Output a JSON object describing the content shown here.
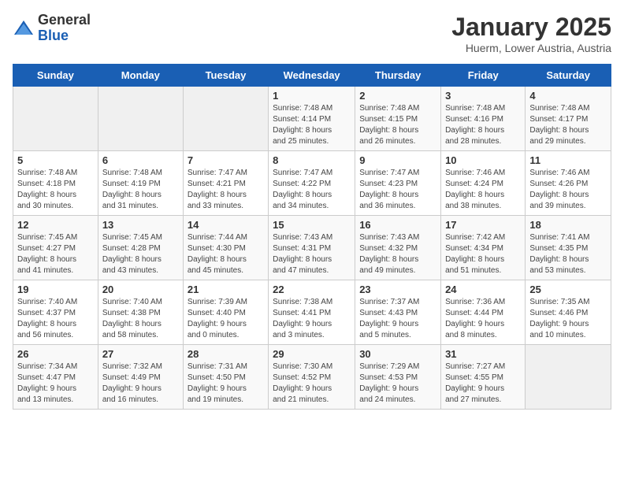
{
  "header": {
    "logo_general": "General",
    "logo_blue": "Blue",
    "month_title": "January 2025",
    "location": "Huerm, Lower Austria, Austria"
  },
  "days_of_week": [
    "Sunday",
    "Monday",
    "Tuesday",
    "Wednesday",
    "Thursday",
    "Friday",
    "Saturday"
  ],
  "weeks": [
    [
      {
        "day": "",
        "info": ""
      },
      {
        "day": "",
        "info": ""
      },
      {
        "day": "",
        "info": ""
      },
      {
        "day": "1",
        "info": "Sunrise: 7:48 AM\nSunset: 4:14 PM\nDaylight: 8 hours\nand 25 minutes."
      },
      {
        "day": "2",
        "info": "Sunrise: 7:48 AM\nSunset: 4:15 PM\nDaylight: 8 hours\nand 26 minutes."
      },
      {
        "day": "3",
        "info": "Sunrise: 7:48 AM\nSunset: 4:16 PM\nDaylight: 8 hours\nand 28 minutes."
      },
      {
        "day": "4",
        "info": "Sunrise: 7:48 AM\nSunset: 4:17 PM\nDaylight: 8 hours\nand 29 minutes."
      }
    ],
    [
      {
        "day": "5",
        "info": "Sunrise: 7:48 AM\nSunset: 4:18 PM\nDaylight: 8 hours\nand 30 minutes."
      },
      {
        "day": "6",
        "info": "Sunrise: 7:48 AM\nSunset: 4:19 PM\nDaylight: 8 hours\nand 31 minutes."
      },
      {
        "day": "7",
        "info": "Sunrise: 7:47 AM\nSunset: 4:21 PM\nDaylight: 8 hours\nand 33 minutes."
      },
      {
        "day": "8",
        "info": "Sunrise: 7:47 AM\nSunset: 4:22 PM\nDaylight: 8 hours\nand 34 minutes."
      },
      {
        "day": "9",
        "info": "Sunrise: 7:47 AM\nSunset: 4:23 PM\nDaylight: 8 hours\nand 36 minutes."
      },
      {
        "day": "10",
        "info": "Sunrise: 7:46 AM\nSunset: 4:24 PM\nDaylight: 8 hours\nand 38 minutes."
      },
      {
        "day": "11",
        "info": "Sunrise: 7:46 AM\nSunset: 4:26 PM\nDaylight: 8 hours\nand 39 minutes."
      }
    ],
    [
      {
        "day": "12",
        "info": "Sunrise: 7:45 AM\nSunset: 4:27 PM\nDaylight: 8 hours\nand 41 minutes."
      },
      {
        "day": "13",
        "info": "Sunrise: 7:45 AM\nSunset: 4:28 PM\nDaylight: 8 hours\nand 43 minutes."
      },
      {
        "day": "14",
        "info": "Sunrise: 7:44 AM\nSunset: 4:30 PM\nDaylight: 8 hours\nand 45 minutes."
      },
      {
        "day": "15",
        "info": "Sunrise: 7:43 AM\nSunset: 4:31 PM\nDaylight: 8 hours\nand 47 minutes."
      },
      {
        "day": "16",
        "info": "Sunrise: 7:43 AM\nSunset: 4:32 PM\nDaylight: 8 hours\nand 49 minutes."
      },
      {
        "day": "17",
        "info": "Sunrise: 7:42 AM\nSunset: 4:34 PM\nDaylight: 8 hours\nand 51 minutes."
      },
      {
        "day": "18",
        "info": "Sunrise: 7:41 AM\nSunset: 4:35 PM\nDaylight: 8 hours\nand 53 minutes."
      }
    ],
    [
      {
        "day": "19",
        "info": "Sunrise: 7:40 AM\nSunset: 4:37 PM\nDaylight: 8 hours\nand 56 minutes."
      },
      {
        "day": "20",
        "info": "Sunrise: 7:40 AM\nSunset: 4:38 PM\nDaylight: 8 hours\nand 58 minutes."
      },
      {
        "day": "21",
        "info": "Sunrise: 7:39 AM\nSunset: 4:40 PM\nDaylight: 9 hours\nand 0 minutes."
      },
      {
        "day": "22",
        "info": "Sunrise: 7:38 AM\nSunset: 4:41 PM\nDaylight: 9 hours\nand 3 minutes."
      },
      {
        "day": "23",
        "info": "Sunrise: 7:37 AM\nSunset: 4:43 PM\nDaylight: 9 hours\nand 5 minutes."
      },
      {
        "day": "24",
        "info": "Sunrise: 7:36 AM\nSunset: 4:44 PM\nDaylight: 9 hours\nand 8 minutes."
      },
      {
        "day": "25",
        "info": "Sunrise: 7:35 AM\nSunset: 4:46 PM\nDaylight: 9 hours\nand 10 minutes."
      }
    ],
    [
      {
        "day": "26",
        "info": "Sunrise: 7:34 AM\nSunset: 4:47 PM\nDaylight: 9 hours\nand 13 minutes."
      },
      {
        "day": "27",
        "info": "Sunrise: 7:32 AM\nSunset: 4:49 PM\nDaylight: 9 hours\nand 16 minutes."
      },
      {
        "day": "28",
        "info": "Sunrise: 7:31 AM\nSunset: 4:50 PM\nDaylight: 9 hours\nand 19 minutes."
      },
      {
        "day": "29",
        "info": "Sunrise: 7:30 AM\nSunset: 4:52 PM\nDaylight: 9 hours\nand 21 minutes."
      },
      {
        "day": "30",
        "info": "Sunrise: 7:29 AM\nSunset: 4:53 PM\nDaylight: 9 hours\nand 24 minutes."
      },
      {
        "day": "31",
        "info": "Sunrise: 7:27 AM\nSunset: 4:55 PM\nDaylight: 9 hours\nand 27 minutes."
      },
      {
        "day": "",
        "info": ""
      }
    ]
  ]
}
